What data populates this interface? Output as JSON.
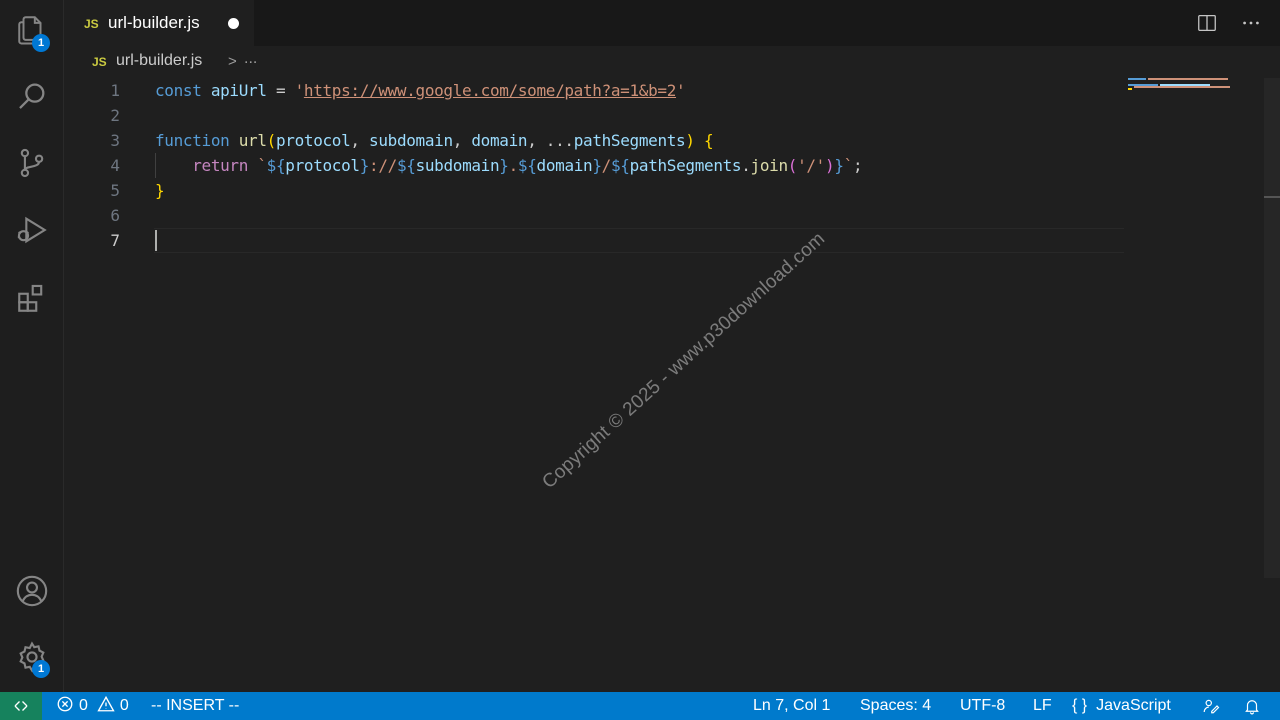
{
  "activity_bar": {
    "explorer_badge": "1",
    "settings_badge": "1"
  },
  "tab": {
    "file_type": "JS",
    "title": "url-builder.js"
  },
  "breadcrumb": {
    "file_type": "JS",
    "file": "url-builder.js",
    "separator": ">",
    "more": "..."
  },
  "editor": {
    "line_numbers": [
      "1",
      "2",
      "3",
      "4",
      "5",
      "6",
      "7"
    ],
    "lines": [
      {
        "tokens": [
          {
            "t": "const",
            "c": "kw-blue"
          },
          {
            "t": " ",
            "c": "punc"
          },
          {
            "t": "apiUrl",
            "c": "var"
          },
          {
            "t": " = ",
            "c": "punc"
          },
          {
            "t": "'",
            "c": "str"
          },
          {
            "t": "https://www.google.com/some/path?a=1&b=2",
            "c": "str-url"
          },
          {
            "t": "'",
            "c": "str"
          }
        ]
      },
      {
        "tokens": []
      },
      {
        "tokens": [
          {
            "t": "function",
            "c": "kw-blue"
          },
          {
            "t": " ",
            "c": "punc"
          },
          {
            "t": "url",
            "c": "fn"
          },
          {
            "t": "(",
            "c": "brace1"
          },
          {
            "t": "protocol",
            "c": "var"
          },
          {
            "t": ", ",
            "c": "punc"
          },
          {
            "t": "subdomain",
            "c": "var"
          },
          {
            "t": ", ",
            "c": "punc"
          },
          {
            "t": "domain",
            "c": "var"
          },
          {
            "t": ", ...",
            "c": "punc"
          },
          {
            "t": "pathSegments",
            "c": "var"
          },
          {
            "t": ")",
            "c": "brace1"
          },
          {
            "t": " ",
            "c": "punc"
          },
          {
            "t": "{",
            "c": "brace1"
          }
        ]
      },
      {
        "tokens": [
          {
            "t": "    ",
            "c": "punc"
          },
          {
            "t": "return",
            "c": "kw-purple"
          },
          {
            "t": " ",
            "c": "punc"
          },
          {
            "t": "`",
            "c": "str"
          },
          {
            "t": "${",
            "c": "tmpl"
          },
          {
            "t": "protocol",
            "c": "var"
          },
          {
            "t": "}",
            "c": "tmpl"
          },
          {
            "t": "://",
            "c": "str"
          },
          {
            "t": "${",
            "c": "tmpl"
          },
          {
            "t": "subdomain",
            "c": "var"
          },
          {
            "t": "}",
            "c": "tmpl"
          },
          {
            "t": ".",
            "c": "str"
          },
          {
            "t": "${",
            "c": "tmpl"
          },
          {
            "t": "domain",
            "c": "var"
          },
          {
            "t": "}",
            "c": "tmpl"
          },
          {
            "t": "/",
            "c": "str"
          },
          {
            "t": "${",
            "c": "tmpl"
          },
          {
            "t": "pathSegments",
            "c": "var"
          },
          {
            "t": ".",
            "c": "punc"
          },
          {
            "t": "join",
            "c": "fn"
          },
          {
            "t": "(",
            "c": "brace2"
          },
          {
            "t": "'/'",
            "c": "str"
          },
          {
            "t": ")",
            "c": "brace2"
          },
          {
            "t": "}",
            "c": "tmpl"
          },
          {
            "t": "`",
            "c": "str"
          },
          {
            "t": ";",
            "c": "punc"
          }
        ]
      },
      {
        "tokens": [
          {
            "t": "}",
            "c": "brace1"
          }
        ]
      },
      {
        "tokens": []
      },
      {
        "tokens": []
      }
    ]
  },
  "watermark": "Copyright © 2025 - www.p30download.com",
  "status_bar": {
    "errors": "0",
    "warnings": "0",
    "mode": "-- INSERT --",
    "position": "Ln 7, Col 1",
    "spaces": "Spaces: 4",
    "encoding": "UTF-8",
    "eol": "LF",
    "language": "JavaScript"
  }
}
